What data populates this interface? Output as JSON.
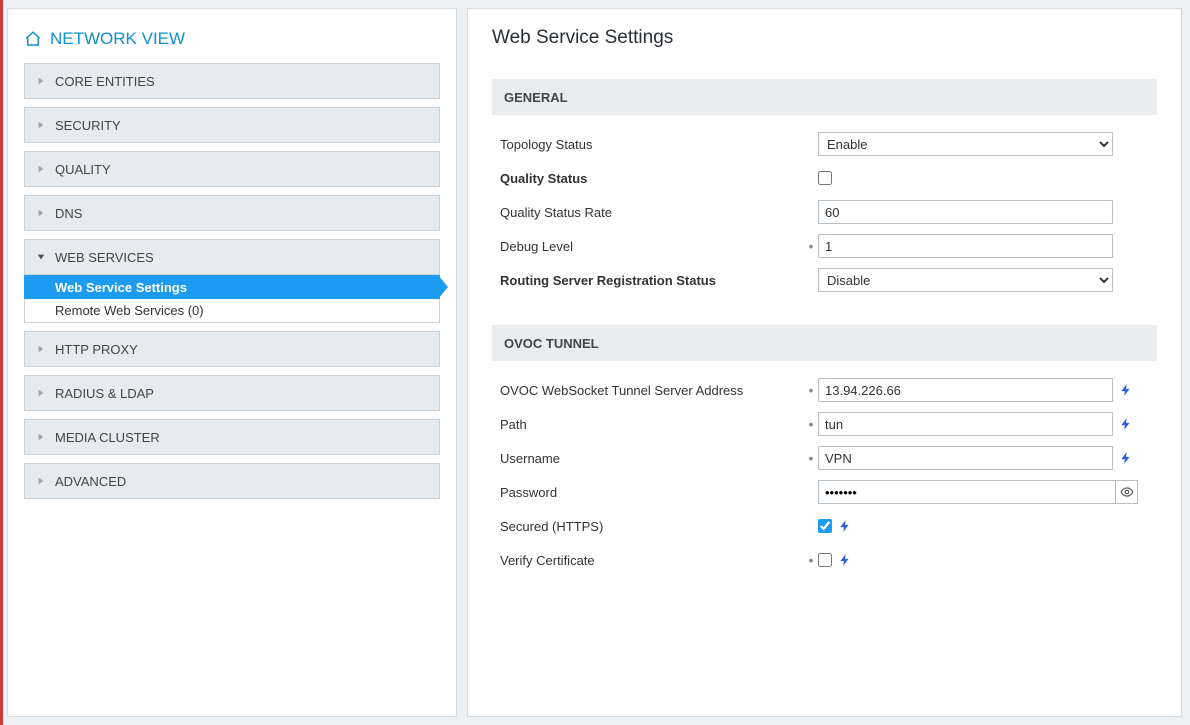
{
  "sidebar": {
    "title": "NETWORK VIEW",
    "items": [
      {
        "label": "CORE ENTITIES",
        "expanded": false
      },
      {
        "label": "SECURITY",
        "expanded": false
      },
      {
        "label": "QUALITY",
        "expanded": false
      },
      {
        "label": "DNS",
        "expanded": false
      },
      {
        "label": "WEB SERVICES",
        "expanded": true,
        "children": [
          {
            "label": "Web Service Settings",
            "active": true
          },
          {
            "label": "Remote Web Services (0)",
            "active": false
          }
        ]
      },
      {
        "label": "HTTP PROXY",
        "expanded": false
      },
      {
        "label": "RADIUS & LDAP",
        "expanded": false
      },
      {
        "label": "MEDIA CLUSTER",
        "expanded": false
      },
      {
        "label": "ADVANCED",
        "expanded": false
      }
    ]
  },
  "main": {
    "title": "Web Service Settings",
    "sections": {
      "general": {
        "header": "GENERAL",
        "topology_status": {
          "label": "Topology Status",
          "value": "Enable"
        },
        "quality_status": {
          "label": "Quality Status",
          "checked": false
        },
        "quality_rate": {
          "label": "Quality Status Rate",
          "value": "60"
        },
        "debug_level": {
          "label": "Debug Level",
          "value": "1"
        },
        "routing_reg": {
          "label": "Routing Server Registration Status",
          "value": "Disable"
        }
      },
      "ovoc": {
        "header": "OVOC TUNNEL",
        "server_addr": {
          "label": "OVOC WebSocket Tunnel Server Address",
          "value": "13.94.226.66"
        },
        "path": {
          "label": "Path",
          "value": "tun"
        },
        "username": {
          "label": "Username",
          "value": "VPN"
        },
        "password": {
          "label": "Password",
          "value": "•••••••"
        },
        "secured": {
          "label": "Secured (HTTPS)",
          "checked": true
        },
        "verify": {
          "label": "Verify Certificate",
          "checked": false
        }
      }
    }
  }
}
